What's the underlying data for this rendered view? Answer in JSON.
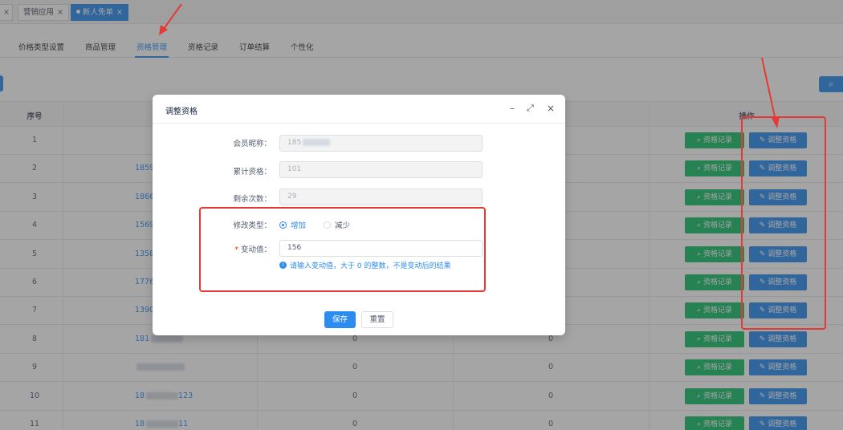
{
  "tabs": [
    {
      "label": "",
      "close": "×"
    },
    {
      "label": "营销应用",
      "close": "×"
    },
    {
      "label": "新人免单",
      "close": "×",
      "active": true
    }
  ],
  "subnav": [
    {
      "label": "价格类型设置"
    },
    {
      "label": "商品管理"
    },
    {
      "label": "资格管理",
      "active": true
    },
    {
      "label": "资格记录"
    },
    {
      "label": "订单结算"
    },
    {
      "label": "个性化"
    }
  ],
  "table": {
    "headers": {
      "index": "序号",
      "actions": "操作"
    },
    "rows": [
      {
        "index": "1",
        "phone": "",
        "col3": "",
        "col4": ""
      },
      {
        "index": "2",
        "phone": "1859",
        "col3": "",
        "col4": ""
      },
      {
        "index": "3",
        "phone": "1866",
        "col3": "",
        "col4": ""
      },
      {
        "index": "4",
        "phone": "1569",
        "col3": "",
        "col4": ""
      },
      {
        "index": "5",
        "phone": "1358",
        "col3": "",
        "col4": ""
      },
      {
        "index": "6",
        "phone": "1776",
        "col3": "",
        "col4": ""
      },
      {
        "index": "7",
        "phone": "1390",
        "col3": "",
        "col4": ""
      },
      {
        "index": "8",
        "phone": "181",
        "col3": "0",
        "col4": "0"
      },
      {
        "index": "9",
        "phone": "",
        "col3": "0",
        "col4": "0"
      },
      {
        "index": "10",
        "phone": "18",
        "phone_tail": "123",
        "col3": "0",
        "col4": "0"
      },
      {
        "index": "11",
        "phone": "18",
        "phone_tail": "11",
        "col3": "0",
        "col4": "0"
      }
    ],
    "record_button": "资格记录",
    "adjust_button": "调整资格"
  },
  "modal": {
    "title": "调整资格",
    "fields": {
      "nickname_label": "会员昵称：",
      "nickname_value": "185",
      "total_label": "累计资格：",
      "total_value": "101",
      "remaining_label": "剩余次数：",
      "remaining_value": "29",
      "type_label": "修改类型：",
      "type_options": [
        "增加",
        "减少"
      ],
      "type_selected": "增加",
      "change_label": "变动值：",
      "change_value": "156",
      "hint": "请输入变动值，大于 0 的整数，不是变动后的结果"
    },
    "save_button": "保存",
    "reset_button": "重置"
  },
  "colors": {
    "primary": "#2d8cf0",
    "success": "#19be6b",
    "annotation": "#e53935"
  }
}
